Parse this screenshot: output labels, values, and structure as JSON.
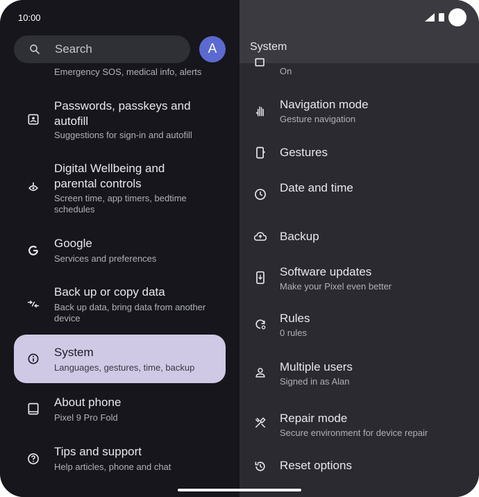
{
  "status": {
    "time": "10:00"
  },
  "search": {
    "placeholder": "Search"
  },
  "avatar": {
    "initial": "A"
  },
  "left_items": [
    {
      "title": "",
      "subtitle": "Emergency SOS, medical info, alerts",
      "icon": "emergency-icon"
    },
    {
      "title": "Passwords, passkeys and autofill",
      "subtitle": "Suggestions for sign-in and autofill",
      "icon": "password-icon"
    },
    {
      "title": "Digital Wellbeing and parental controls",
      "subtitle": "Screen time, app timers, bedtime schedules",
      "icon": "wellbeing-icon"
    },
    {
      "title": "Google",
      "subtitle": "Services and preferences",
      "icon": "google-icon"
    },
    {
      "title": "Back up or copy data",
      "subtitle": "Back up data, bring data from another device",
      "icon": "backup-copy-icon"
    },
    {
      "title": "System",
      "subtitle": "Languages, gestures, time, backup",
      "icon": "info-icon",
      "selected": true
    },
    {
      "title": "About phone",
      "subtitle": "Pixel 9 Pro Fold",
      "icon": "phone-icon"
    },
    {
      "title": "Tips and support",
      "subtitle": "Help articles, phone and chat",
      "icon": "help-icon"
    }
  ],
  "right_header": {
    "title": "System"
  },
  "right_items": [
    {
      "title": "",
      "subtitle": "On",
      "icon": "display-icon"
    },
    {
      "title": "Navigation mode",
      "subtitle": "Gesture navigation",
      "icon": "gesture-hand-icon"
    },
    {
      "title": "Gestures",
      "subtitle": "",
      "icon": "gestures-phone-icon"
    },
    {
      "title": "Date and time",
      "subtitle": "",
      "icon": "clock-icon"
    },
    {
      "title": "Backup",
      "subtitle": "",
      "icon": "cloud-upload-icon"
    },
    {
      "title": "Software updates",
      "subtitle": "Make your Pixel even better",
      "icon": "system-update-icon"
    },
    {
      "title": "Rules",
      "subtitle": "0 rules",
      "icon": "rules-icon"
    },
    {
      "title": "Multiple users",
      "subtitle": "Signed in as Alan",
      "icon": "person-icon"
    },
    {
      "title": "Repair mode",
      "subtitle": "Secure environment for device repair",
      "icon": "repair-icon"
    },
    {
      "title": "Reset options",
      "subtitle": "",
      "icon": "reset-icon"
    }
  ]
}
